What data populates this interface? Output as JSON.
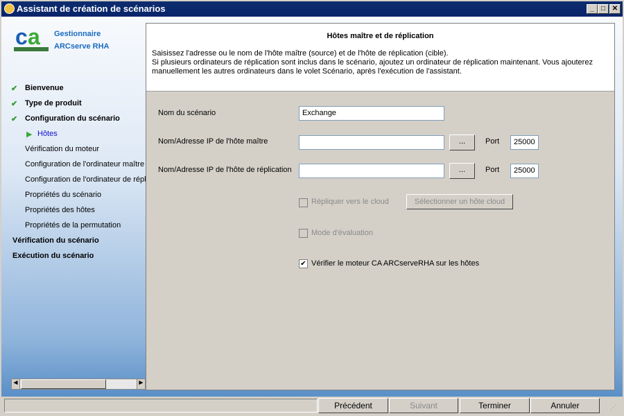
{
  "window": {
    "title": "Assistant de création de scénarios",
    "minimize": "_",
    "maximize": "□",
    "close": "✕"
  },
  "brand": {
    "line1": "Gestionnaire",
    "line2": "ARCserve RHA",
    "logo_text": "ca technologies",
    "accent": "#1a6bbf"
  },
  "steps": [
    {
      "label": "Bienvenue",
      "state": "done"
    },
    {
      "label": "Type de produit",
      "state": "done"
    },
    {
      "label": "Configuration du scénario",
      "state": "done"
    },
    {
      "label": "Hôtes",
      "state": "current"
    },
    {
      "label": "Vérification du moteur",
      "state": "sub"
    },
    {
      "label": "Configuration de l'ordinateur maître",
      "state": "sub"
    },
    {
      "label": "Configuration de l'ordinateur de répl",
      "state": "sub"
    },
    {
      "label": "Propriétés du scénario",
      "state": "sub"
    },
    {
      "label": "Propriétés des hôtes",
      "state": "sub"
    },
    {
      "label": "Propriétés de la permutation",
      "state": "sub"
    },
    {
      "label": "Vérification du scénario",
      "state": "top"
    },
    {
      "label": "Exécution du scénario",
      "state": "top"
    }
  ],
  "header": {
    "title": "Hôtes maître et de réplication",
    "description": "Saisissez l'adresse ou le nom de l'hôte maître (source) et de l'hôte de réplication (cible).\nSi plusieurs ordinateurs de réplication sont inclus dans le scénario, ajoutez un ordinateur de réplication maintenant. Vous ajouterez manuellement les autres ordinateurs dans le volet Scénario, après l'exécution de l'assistant."
  },
  "form": {
    "scenario_label": "Nom du scénario",
    "scenario_value": "Exchange",
    "master_label": "Nom/Adresse IP de l'hôte maître",
    "master_value": "",
    "master_port_label": "Port",
    "master_port": "25000",
    "replica_label": "Nom/Adresse IP de l'hôte de réplication",
    "replica_value": "",
    "replica_port_label": "Port",
    "replica_port": "25000",
    "browse": "...",
    "cloud_label": "Répliquer vers le cloud",
    "cloud_checked": false,
    "cloud_button": "Sélectionner un hôte cloud",
    "eval_label": "Mode d'évaluation",
    "eval_checked": false,
    "verify_label": "Vérifier le moteur CA ARCserveRHA sur les hôtes",
    "verify_checked": true,
    "check_mark": "✔"
  },
  "footer": {
    "previous": "Précédent",
    "next": "Suivant",
    "finish": "Terminer",
    "cancel": "Annuler"
  }
}
